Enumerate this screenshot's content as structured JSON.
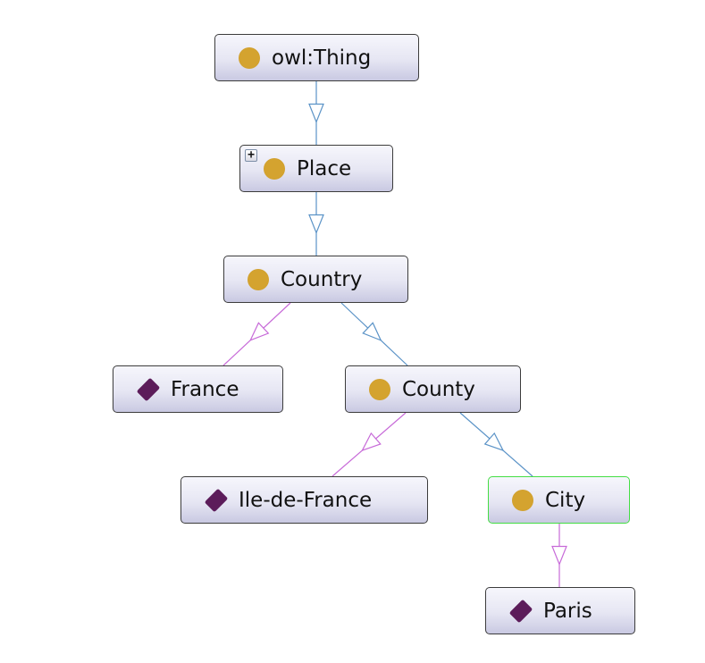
{
  "diagram": {
    "type": "ontology-class-hierarchy",
    "colors": {
      "class_icon": "#d4a32f",
      "individual_icon": "#5c1c5a",
      "subclass_edge": "#5b93c7",
      "instance_edge": "#c76ad8",
      "selected_border": "#44dd44"
    },
    "nodes": [
      {
        "id": "owl-thing",
        "label": "owl:Thing",
        "kind": "class",
        "expandable": false,
        "selected": false
      },
      {
        "id": "place",
        "label": "Place",
        "kind": "class",
        "expandable": true,
        "expand_symbol": "+",
        "selected": false
      },
      {
        "id": "country",
        "label": "Country",
        "kind": "class",
        "expandable": false,
        "selected": false
      },
      {
        "id": "france",
        "label": "France",
        "kind": "individual",
        "expandable": false,
        "selected": false
      },
      {
        "id": "county",
        "label": "County",
        "kind": "class",
        "expandable": false,
        "selected": false
      },
      {
        "id": "ile-de-france",
        "label": "Ile-de-France",
        "kind": "individual",
        "expandable": false,
        "selected": false
      },
      {
        "id": "city",
        "label": "City",
        "kind": "class",
        "expandable": false,
        "selected": true
      },
      {
        "id": "paris",
        "label": "Paris",
        "kind": "individual",
        "expandable": false,
        "selected": false
      }
    ],
    "edges": [
      {
        "from": "owl-thing",
        "to": "place",
        "relation": "subclass"
      },
      {
        "from": "place",
        "to": "country",
        "relation": "subclass"
      },
      {
        "from": "country",
        "to": "france",
        "relation": "instance"
      },
      {
        "from": "country",
        "to": "county",
        "relation": "subclass"
      },
      {
        "from": "county",
        "to": "ile-de-france",
        "relation": "instance"
      },
      {
        "from": "county",
        "to": "city",
        "relation": "subclass"
      },
      {
        "from": "city",
        "to": "paris",
        "relation": "instance"
      }
    ]
  }
}
